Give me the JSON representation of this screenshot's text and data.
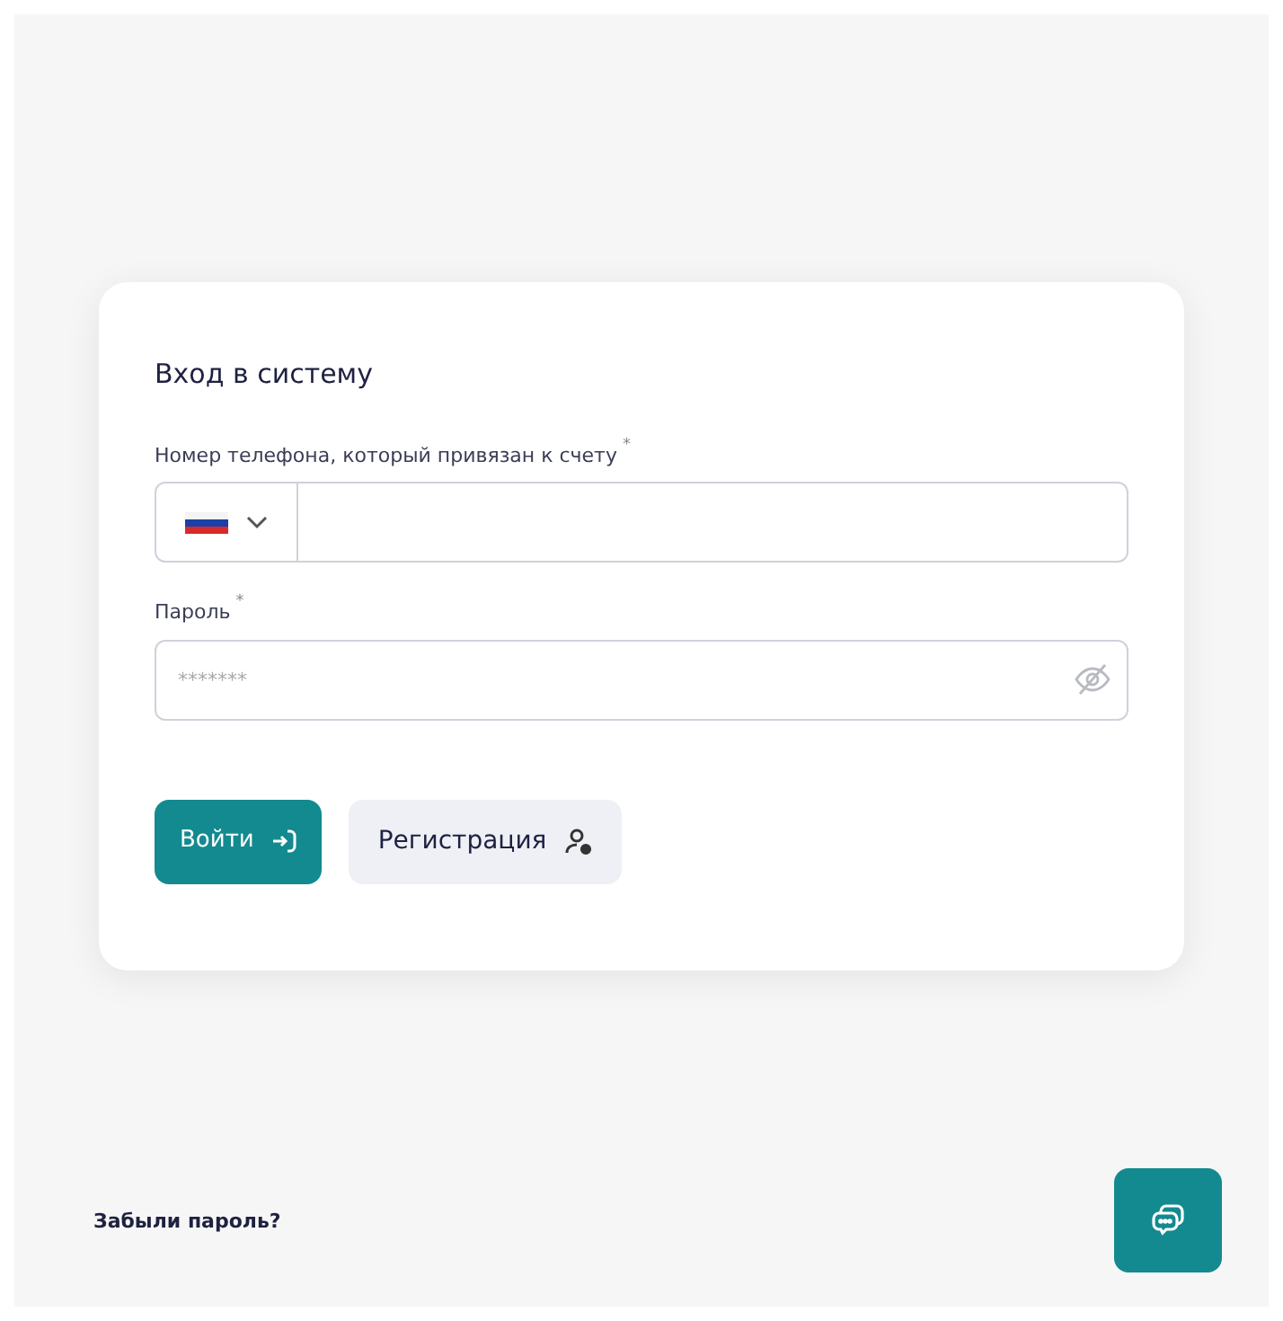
{
  "login_card": {
    "title": "Вход в систему",
    "fields": [
      {
        "kind": "phone",
        "label": "Номер телефона, который привязан к счету",
        "required_mark": "*"
      },
      {
        "kind": "password",
        "label": "Пароль",
        "required_mark": "*",
        "placeholder": "*******"
      }
    ],
    "buttons": [
      {
        "kind": "primary",
        "label": "Войти"
      },
      {
        "kind": "secondary",
        "label": "Регистрация"
      }
    ]
  },
  "forgot_link": "Забыли пароль?"
}
